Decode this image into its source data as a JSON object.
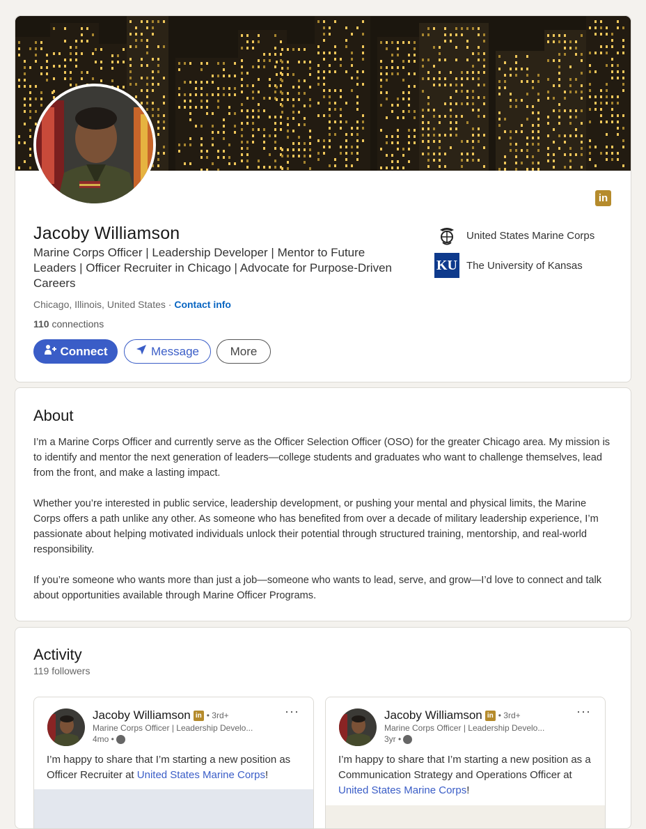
{
  "profile": {
    "name": "Jacoby Williamson",
    "headline": "Marine Corps Officer | Leadership Developer | Mentor to Future Leaders | Officer Recruiter in Chicago | Advocate for Purpose-Driven Careers",
    "location": "Chicago, Illinois, United States",
    "separator": " · ",
    "contact_info": "Contact info",
    "connections_count": "110",
    "connections_label": " connections",
    "badge_icon": "linkedin-icon",
    "buttons": {
      "connect": "Connect",
      "message": "Message",
      "more": "More"
    },
    "orgs": [
      {
        "name": "United States Marine Corps",
        "icon": "eagle-globe-anchor-icon"
      },
      {
        "name": "The University of Kansas",
        "logo_text": "KU",
        "icon": "ku-logo"
      }
    ]
  },
  "about": {
    "title": "About",
    "text": "I’m a Marine Corps Officer and currently serve as the Officer Selection Officer (OSO) for the greater Chicago area. My mission is to identify and mentor the next generation of leaders—college students and graduates who want to challenge themselves, lead from the front, and make a lasting impact.\n\nWhether you’re interested in public service, leadership development, or pushing your mental and physical limits, the Marine Corps offers a path unlike any other. As someone who has benefited from over a decade of military leadership experience, I’m passionate about helping motivated individuals unlock their potential through structured training, mentorship, and real-world responsibility.\n\nIf you’re someone who wants more than just a job—someone who wants to lead, serve, and grow—I’d love to connect and talk about opportunities available through Marine Officer Programs."
  },
  "activity": {
    "title": "Activity",
    "followers": "119 followers",
    "posts": [
      {
        "author": "Jacoby Williamson",
        "badge": "in",
        "degree": "• 3rd+",
        "headline": "Marine Corps Officer | Leadership Develo...",
        "time": "4mo •",
        "menu": "···",
        "text_before": "I’m happy to share that I’m starting a new position as Officer Recruiter at ",
        "mention": "United States Marine Corps",
        "text_after": "!"
      },
      {
        "author": "Jacoby Williamson",
        "badge": "in",
        "degree": "• 3rd+",
        "headline": "Marine Corps Officer | Leadership Develo...",
        "time": "3yr •",
        "menu": "···",
        "text_before": "I’m happy to share that I’m starting a new position as a Communication Strategy and Operations Officer at ",
        "mention": "United States Marine Corps",
        "text_after": "!"
      }
    ]
  },
  "colors": {
    "accent": "#3a5dc7",
    "badge": "#b58b2c",
    "ku_blue": "#0e3a8c",
    "background": "#f4f2ee"
  }
}
